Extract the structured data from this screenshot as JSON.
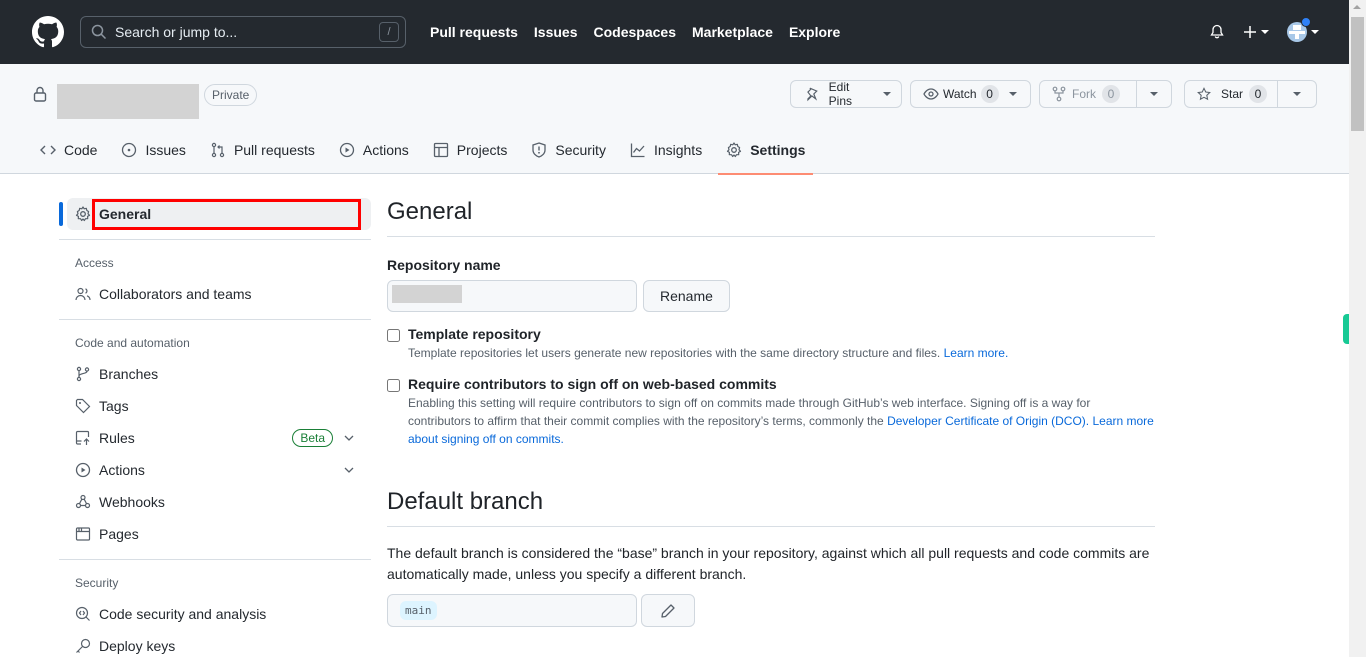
{
  "header": {
    "logo_icon": "github-mark-icon",
    "search_placeholder": "Search or jump to...",
    "search_shortcut": "/",
    "nav": [
      "Pull requests",
      "Issues",
      "Codespaces",
      "Marketplace",
      "Explore"
    ],
    "right_icons": [
      "bell-icon",
      "plus-icon",
      "avatar"
    ]
  },
  "repo": {
    "visibility": "Private",
    "buttons": {
      "edit_pins": "Edit Pins",
      "watch": "Watch",
      "watch_count": "0",
      "fork": "Fork",
      "fork_count": "0",
      "star": "Star",
      "star_count": "0"
    },
    "tabs": [
      {
        "label": "Code",
        "icon": "code-icon"
      },
      {
        "label": "Issues",
        "icon": "issue-opened-icon"
      },
      {
        "label": "Pull requests",
        "icon": "git-pull-request-icon"
      },
      {
        "label": "Actions",
        "icon": "play-icon"
      },
      {
        "label": "Projects",
        "icon": "table-icon"
      },
      {
        "label": "Security",
        "icon": "shield-icon"
      },
      {
        "label": "Insights",
        "icon": "graph-icon"
      },
      {
        "label": "Settings",
        "icon": "gear-icon",
        "active": true
      }
    ]
  },
  "sidebar": {
    "general": "General",
    "sections": [
      {
        "heading": "Access",
        "items": [
          {
            "label": "Collaborators and teams"
          }
        ]
      },
      {
        "heading": "Code and automation",
        "items": [
          {
            "label": "Branches"
          },
          {
            "label": "Tags"
          },
          {
            "label": "Rules",
            "badge": "Beta"
          },
          {
            "label": "Actions"
          },
          {
            "label": "Webhooks"
          },
          {
            "label": "Pages"
          }
        ]
      },
      {
        "heading": "Security",
        "items": [
          {
            "label": "Code security and analysis"
          },
          {
            "label": "Deploy keys"
          }
        ]
      }
    ]
  },
  "main": {
    "general_title": "General",
    "repo_name_label": "Repository name",
    "rename_button": "Rename",
    "template": {
      "title": "Template repository",
      "desc": "Template repositories let users generate new repositories with the same directory structure and files.",
      "link": "Learn more."
    },
    "signoff": {
      "title": "Require contributors to sign off on web-based commits",
      "desc": "Enabling this setting will require contributors to sign off on commits made through GitHub’s web interface. Signing off is a way for contributors to affirm that their commit complies with the repository’s terms, commonly the",
      "link1": "Developer Certificate of Origin (DCO).",
      "link2": "Learn more about signing off on commits."
    },
    "default_branch_title": "Default branch",
    "default_branch_desc": "The default branch is considered the “base” branch in your repository, against which all pull requests and code commits are automatically made, unless you specify a different branch.",
    "default_branch_value": "main"
  },
  "colors": {
    "header_bg": "#24292f",
    "accent_underline": "#fd8c73",
    "link": "#0969da",
    "highlight_box": "#ff0000",
    "beta_green": "#1a7f37"
  }
}
